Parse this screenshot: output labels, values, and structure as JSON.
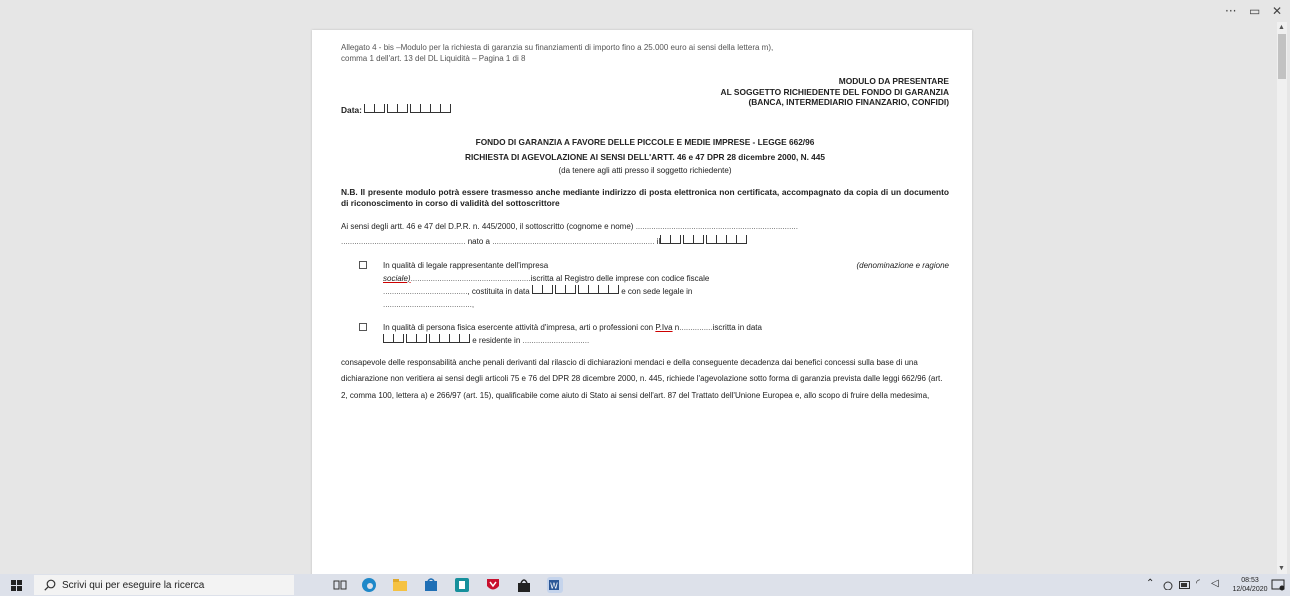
{
  "window": {
    "controls": [
      "···",
      "▭",
      "✕"
    ]
  },
  "doc": {
    "header_line1": "Allegato 4 - bis –Modulo per la richiesta di garanzia su finanziamenti di importo fino a 25.000 euro ai sensi della lettera m),",
    "header_line2": "comma 1 dell'art. 13 del DL Liquidità – Pagina 1 di 8",
    "right1": "MODULO DA PRESENTARE",
    "right2": "AL SOGGETTO RICHIEDENTE DEL FONDO DI GARANZIA",
    "right3": "(BANCA, INTERMEDIARIO FINANZARIO, CONFIDI)",
    "date_label": "Data:",
    "title1": "FONDO DI GARANZIA A FAVORE DELLE PICCOLE E MEDIE IMPRESE - LEGGE 662/96",
    "title2": "RICHIESTA DI AGEVOLAZIONE AI SENSI DELL'ARTT. 46 e 47 DPR 28 dicembre 2000, N. 445",
    "subtitle": "(da tenere agli atti presso il soggetto richiedente)",
    "nb": "N.B. Il presente modulo potrà essere trasmesso anche mediante indirizzo di posta elettronica non certificata, accompagnato da copia di un documento di riconoscimento in corso di validità del sottoscrittore",
    "p1_a": "Ai sensi degli artt. 46 e 47 del D.P.R. n. 445/2000, il sottoscritto (cognome e nome)",
    "p1_b": "nato a",
    "p1_c": "il",
    "opt1_a": "In qualità di legale rappresentante dell'impresa",
    "opt1_b": "(denominazione e ragione",
    "opt1_c": "sociale)",
    "opt1_d": "iscritta al Registro delle imprese con codice fiscale",
    "opt1_e": ", costituita in data",
    "opt1_f": "e con sede legale in",
    "opt2_a": "In qualità di persona fisica esercente attività d'impresa, arti o professioni con",
    "opt2_piva": "P.Iva",
    "opt2_b": "n",
    "opt2_c": "iscritta in data",
    "opt2_d": "e residente in",
    "body": "consapevole delle responsabilità anche penali derivanti dal rilascio di dichiarazioni mendaci e della conseguente decadenza dai benefici concessi sulla base di una dichiarazione non veritiera ai sensi degli articoli 75 e 76 del DPR 28 dicembre 2000, n. 445, richiede l'agevolazione sotto forma di garanzia prevista dalle leggi 662/96 (art. 2, comma 100, lettera a) e 266/97 (art. 15), qualificabile come aiuto di Stato ai sensi dell'art. 87 del Trattato dell'Unione Europea e, allo scopo di fruire della medesima,"
  },
  "taskbar": {
    "search_placeholder": "Scrivi qui per eseguire la ricerca",
    "time": "08:53",
    "date": "12/04/2020"
  }
}
